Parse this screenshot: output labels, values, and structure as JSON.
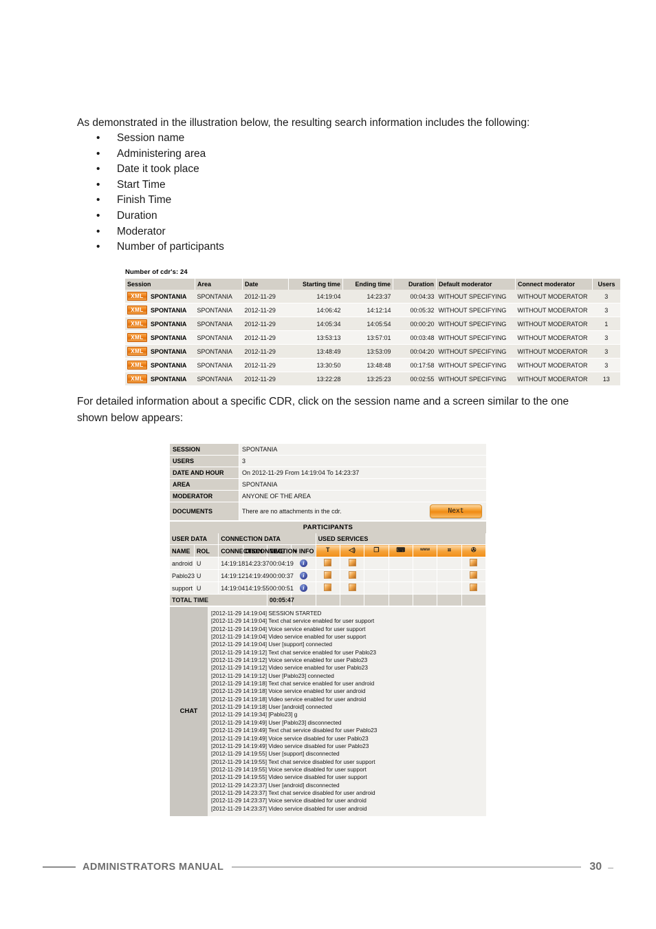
{
  "document": {
    "intro_paragraph": "As demonstrated in the illustration below, the resulting search information includes the following:",
    "bullets": [
      "Session name",
      "Administering area",
      "Date it took place",
      "Start Time",
      "Finish Time",
      "Duration",
      "Moderator",
      "Number of participants"
    ],
    "mid_paragraph": "For detailed information about a specific CDR, click on the session name and a screen similar to the one shown below appears:",
    "bullet_glyph": "•"
  },
  "cdr_list": {
    "count_label": "Number of cdr's:  24",
    "columns": [
      "Session",
      "Area",
      "Date",
      "Starting time",
      "Ending time",
      "Duration",
      "Default moderator",
      "Connect moderator",
      "Users"
    ],
    "xml_badge_label": "XML",
    "rows": [
      {
        "session": "SPONTANIA",
        "area": "SPONTANIA",
        "date": "2012-11-29",
        "start": "14:19:04",
        "end": "14:23:37",
        "duration": "00:04:33",
        "default_moderator": "WITHOUT SPECIFYING",
        "connect_moderator": "WITHOUT MODERATOR",
        "users": "3"
      },
      {
        "session": "SPONTANIA",
        "area": "SPONTANIA",
        "date": "2012-11-29",
        "start": "14:06:42",
        "end": "14:12:14",
        "duration": "00:05:32",
        "default_moderator": "WITHOUT SPECIFYING",
        "connect_moderator": "WITHOUT MODERATOR",
        "users": "3"
      },
      {
        "session": "SPONTANIA",
        "area": "SPONTANIA",
        "date": "2012-11-29",
        "start": "14:05:34",
        "end": "14:05:54",
        "duration": "00:00:20",
        "default_moderator": "WITHOUT SPECIFYING",
        "connect_moderator": "WITHOUT MODERATOR",
        "users": "1"
      },
      {
        "session": "SPONTANIA",
        "area": "SPONTANIA",
        "date": "2012-11-29",
        "start": "13:53:13",
        "end": "13:57:01",
        "duration": "00:03:48",
        "default_moderator": "WITHOUT SPECIFYING",
        "connect_moderator": "WITHOUT MODERATOR",
        "users": "3"
      },
      {
        "session": "SPONTANIA",
        "area": "SPONTANIA",
        "date": "2012-11-29",
        "start": "13:48:49",
        "end": "13:53:09",
        "duration": "00:04:20",
        "default_moderator": "WITHOUT SPECIFYING",
        "connect_moderator": "WITHOUT MODERATOR",
        "users": "3"
      },
      {
        "session": "SPONTANIA",
        "area": "SPONTANIA",
        "date": "2012-11-29",
        "start": "13:30:50",
        "end": "13:48:48",
        "duration": "00:17:58",
        "default_moderator": "WITHOUT SPECIFYING",
        "connect_moderator": "WITHOUT MODERATOR",
        "users": "3"
      },
      {
        "session": "SPONTANIA",
        "area": "SPONTANIA",
        "date": "2012-11-29",
        "start": "13:22:28",
        "end": "13:25:23",
        "duration": "00:02:55",
        "default_moderator": "WITHOUT SPECIFYING",
        "connect_moderator": "WITHOUT MODERATOR",
        "users": "13"
      }
    ]
  },
  "cdr_detail": {
    "summary": [
      {
        "label": "SESSION",
        "value": "SPONTANIA"
      },
      {
        "label": "USERS",
        "value": "3"
      },
      {
        "label": "DATE AND HOUR",
        "value": "On  2012-11-29  From  14:19:04  To  14:23:37"
      },
      {
        "label": "AREA",
        "value": "SPONTANIA"
      },
      {
        "label": "MODERATOR",
        "value": "ANYONE OF THE AREA"
      }
    ],
    "documents_label": "DOCUMENTS",
    "documents_value": "There are no attachments in the cdr.",
    "next_button": "Next",
    "participants_title": "PARTICIPANTS",
    "group_headers": {
      "user_data": "USER DATA",
      "connection_data": "CONNECTION DATA",
      "used_services": "USED SERVICES"
    },
    "columns": {
      "name": "NAME",
      "rol": "ROL",
      "connection": "CONNECTION",
      "disconnection": "DISCONNECTION",
      "time": "TIME",
      "info": "+ INFO"
    },
    "service_icons": [
      {
        "name": "text-chat-icon",
        "glyph": "T"
      },
      {
        "name": "voice-icon",
        "glyph": "◁)"
      },
      {
        "name": "document-share-icon",
        "glyph": "❐"
      },
      {
        "name": "remote-control-icon",
        "glyph": "⌨"
      },
      {
        "name": "web-cobrowsing-icon",
        "glyph": "www"
      },
      {
        "name": "whiteboard-icon",
        "glyph": "⌗"
      },
      {
        "name": "video-icon",
        "glyph": "✇"
      }
    ],
    "info_icon_glyph": "i",
    "participants": [
      {
        "name": "android",
        "rol": "U",
        "connection": "14:19:18",
        "disconnection": "14:23:37",
        "time": "00:04:19",
        "services": [
          true,
          true,
          false,
          false,
          false,
          false,
          true
        ]
      },
      {
        "name": "Pablo23",
        "rol": "U",
        "connection": "14:19:12",
        "disconnection": "14:19:49",
        "time": "00:00:37",
        "services": [
          true,
          true,
          false,
          false,
          false,
          false,
          true
        ]
      },
      {
        "name": "support",
        "rol": "U",
        "connection": "14:19:04",
        "disconnection": "14:19:55",
        "time": "00:00:51",
        "services": [
          true,
          true,
          false,
          false,
          false,
          false,
          true
        ]
      }
    ],
    "total_time_label": "TOTAL TIME",
    "total_time_value": "00:05:47",
    "chat_label": "CHAT",
    "chat_lines": [
      "[2012-11-29 14:19:04] SESSION STARTED",
      "[2012-11-29 14:19:04] Text chat service enabled for user support",
      "[2012-11-29 14:19:04] Voice service enabled for user support",
      "[2012-11-29 14:19:04] Video service enabled for user support",
      "[2012-11-29 14:19:04] User [support] connected",
      "[2012-11-29 14:19:12] Text chat service enabled for user Pablo23",
      "[2012-11-29 14:19:12] Voice service enabled for user Pablo23",
      "[2012-11-29 14:19:12] Video service enabled for user Pablo23",
      "[2012-11-29 14:19:12] User [Pablo23] connected",
      "[2012-11-29 14:19:18] Text chat service enabled for user android",
      "[2012-11-29 14:19:18] Voice service enabled for user android",
      "[2012-11-29 14:19:18] Video service enabled for user android",
      "[2012-11-29 14:19:18] User [android] connected",
      "[2012-11-29 14:19:34] [Pablo23] g",
      "[2012-11-29 14:19:49] User [Pablo23] disconnected",
      "[2012-11-29 14:19:49] Text chat service disabled for user Pablo23",
      "[2012-11-29 14:19:49] Voice service disabled for user Pablo23",
      "[2012-11-29 14:19:49] Video service disabled for user Pablo23",
      "[2012-11-29 14:19:55] User [support] disconnected",
      "[2012-11-29 14:19:55] Text chat service disabled for user support",
      "[2012-11-29 14:19:55] Voice service disabled for user support",
      "[2012-11-29 14:19:55] Video service disabled for user support",
      "[2012-11-29 14:23:37] User [android] disconnected",
      "[2012-11-29 14:23:37] Text chat service disabled for user android",
      "[2012-11-29 14:23:37] Voice service disabled for user android",
      "[2012-11-29 14:23:37] Video service disabled for user android"
    ]
  },
  "footer": {
    "title": "ADMINISTRATORS MANUAL",
    "page_number": "30",
    "trailing_dash": "–"
  },
  "colors": {
    "accent_orange": "#f08a12",
    "header_gray": "#d4d0c8",
    "row_gray": "#f2f1ee",
    "info_blue": "#39469a",
    "footer_gray": "#6e6e6e"
  }
}
